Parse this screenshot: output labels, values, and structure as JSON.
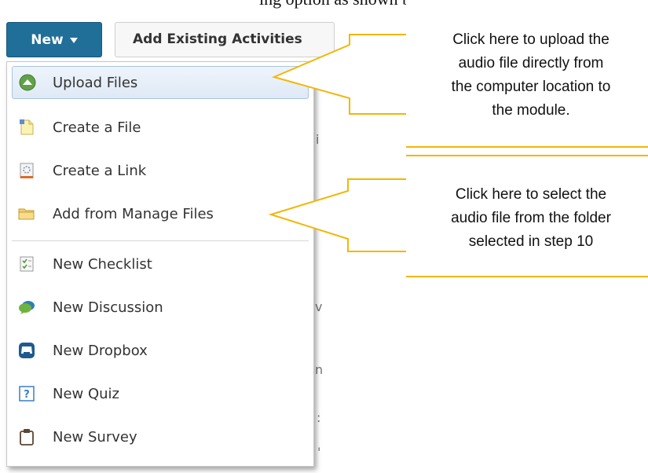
{
  "top_text": "ing option as shown by",
  "toolbar": {
    "new_label": "New",
    "add_existing_label": "Add Existing Activities"
  },
  "menu": {
    "items": [
      {
        "label": "Upload Files",
        "icon": "upload-icon"
      },
      {
        "label": "Create a File",
        "icon": "create-file-icon"
      },
      {
        "label": "Create a Link",
        "icon": "create-link-icon"
      },
      {
        "label": "Add from Manage Files",
        "icon": "folder-icon"
      },
      {
        "label": "New Checklist",
        "icon": "checklist-icon"
      },
      {
        "label": "New Discussion",
        "icon": "discussion-icon"
      },
      {
        "label": "New Dropbox",
        "icon": "dropbox-icon"
      },
      {
        "label": "New Quiz",
        "icon": "quiz-icon"
      },
      {
        "label": "New Survey",
        "icon": "survey-icon"
      }
    ]
  },
  "callouts": [
    {
      "lines": [
        "Click here to upload the",
        "audio file directly from",
        "the computer location to",
        "the module."
      ]
    },
    {
      "lines": [
        "Click here to select the",
        "audio file from the folder",
        "selected in step 10"
      ]
    }
  ],
  "colors": {
    "new_button": "#1f6f99",
    "callout_border": "#f2b705",
    "selected_item": "#dfe9f6"
  }
}
